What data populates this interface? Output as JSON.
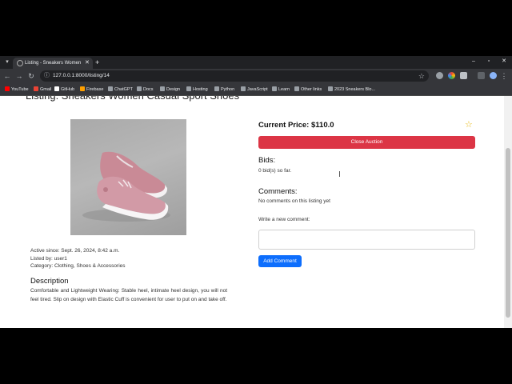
{
  "browser": {
    "tab_title": "Listing - Sneakers Women Casu",
    "url": "127.0.0.1:8000/listing/14",
    "bookmarks": [
      {
        "label": "YouTube",
        "color": "#ff0000"
      },
      {
        "label": "Gmail",
        "color": "#ea4335"
      },
      {
        "label": "GitHub",
        "color": "#ffffff"
      },
      {
        "label": "Firebase",
        "color": "#ffa000"
      },
      {
        "label": "ChatGPT",
        "color": "#9aa0a6"
      },
      {
        "label": "Docs",
        "color": "#9aa0a6"
      },
      {
        "label": "Design",
        "color": "#9aa0a6"
      },
      {
        "label": "Hosting",
        "color": "#9aa0a6"
      },
      {
        "label": "Python",
        "color": "#9aa0a6"
      },
      {
        "label": "JavaScript",
        "color": "#9aa0a6"
      },
      {
        "label": "Learn",
        "color": "#9aa0a6"
      },
      {
        "label": "Other links",
        "color": "#9aa0a6"
      },
      {
        "label": "2023 Sneakers Blo...",
        "color": "#9aa0a6"
      }
    ]
  },
  "listing": {
    "title": "Listing: Sneakers Women Casual Sport Shoes",
    "active_since": "Active since: Sept. 26, 2024, 8:42 a.m.",
    "listed_by": "Listed by: user1",
    "category": "Category: Clothing, Shoes & Accessories",
    "description_heading": "Description",
    "description": "Comfortable and Lightweight Wearing: Stable heel, intimate heel design, you will not feel tired. Slip on design with Elastic Cuff is convenient for user to put on and take off."
  },
  "auction": {
    "current_price": "Current Price: $110.0",
    "close_label": "Close Auction",
    "bids_heading": "Bids:",
    "bids_text": "0 bid(s) so far.",
    "comments_heading": "Comments:",
    "comments_text": "No comments on this listing yet",
    "new_comment_label": "Write a new comment:",
    "add_comment_label": "Add Comment"
  },
  "colors": {
    "danger": "#dc3545",
    "primary": "#0d6efd",
    "star": "#e7b711"
  },
  "icons": {
    "watchlist": "star-outline-icon"
  }
}
